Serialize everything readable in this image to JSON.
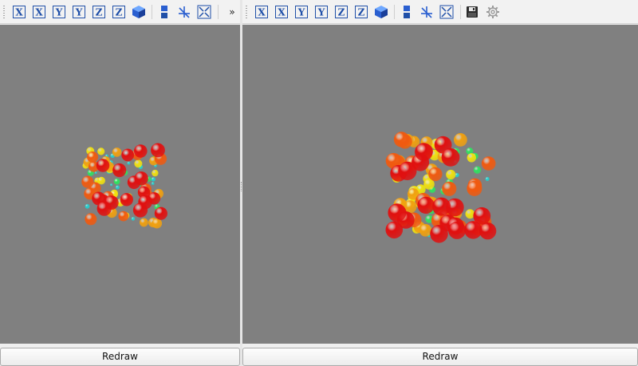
{
  "toolbar": {
    "buttons": [
      {
        "name": "view-x-positive",
        "glyph": "X",
        "kind": "axis"
      },
      {
        "name": "view-x-negative",
        "glyph": "X",
        "kind": "axis"
      },
      {
        "name": "view-y-positive",
        "glyph": "Y",
        "kind": "axis"
      },
      {
        "name": "view-y-negative",
        "glyph": "Y",
        "kind": "axis"
      },
      {
        "name": "view-z-positive",
        "glyph": "Z",
        "kind": "axis"
      },
      {
        "name": "view-z-negative",
        "glyph": "Z",
        "kind": "axis"
      },
      {
        "name": "view-isometric",
        "kind": "cube-icon"
      },
      {
        "name": "toggle-parallel",
        "kind": "parallel-icon"
      },
      {
        "name": "reset-rotation",
        "kind": "star-axes-icon"
      },
      {
        "name": "fit-to-view",
        "kind": "fit-arrows-icon"
      }
    ],
    "extra_right": [
      {
        "name": "save",
        "kind": "floppy-disk-icon"
      },
      {
        "name": "settings",
        "kind": "gear-icon"
      }
    ],
    "overflow_glyph": "»"
  },
  "left_panel": {
    "redraw_label": "Redraw"
  },
  "right_panel": {
    "redraw_label": "Redraw"
  },
  "colors": {
    "viewport_bg": "#808080",
    "icon_blue": "#1f4fa8",
    "sphere_palette": [
      "#e01010",
      "#f05a10",
      "#f0a010",
      "#f0e010",
      "#30e060",
      "#20d0d0"
    ]
  }
}
